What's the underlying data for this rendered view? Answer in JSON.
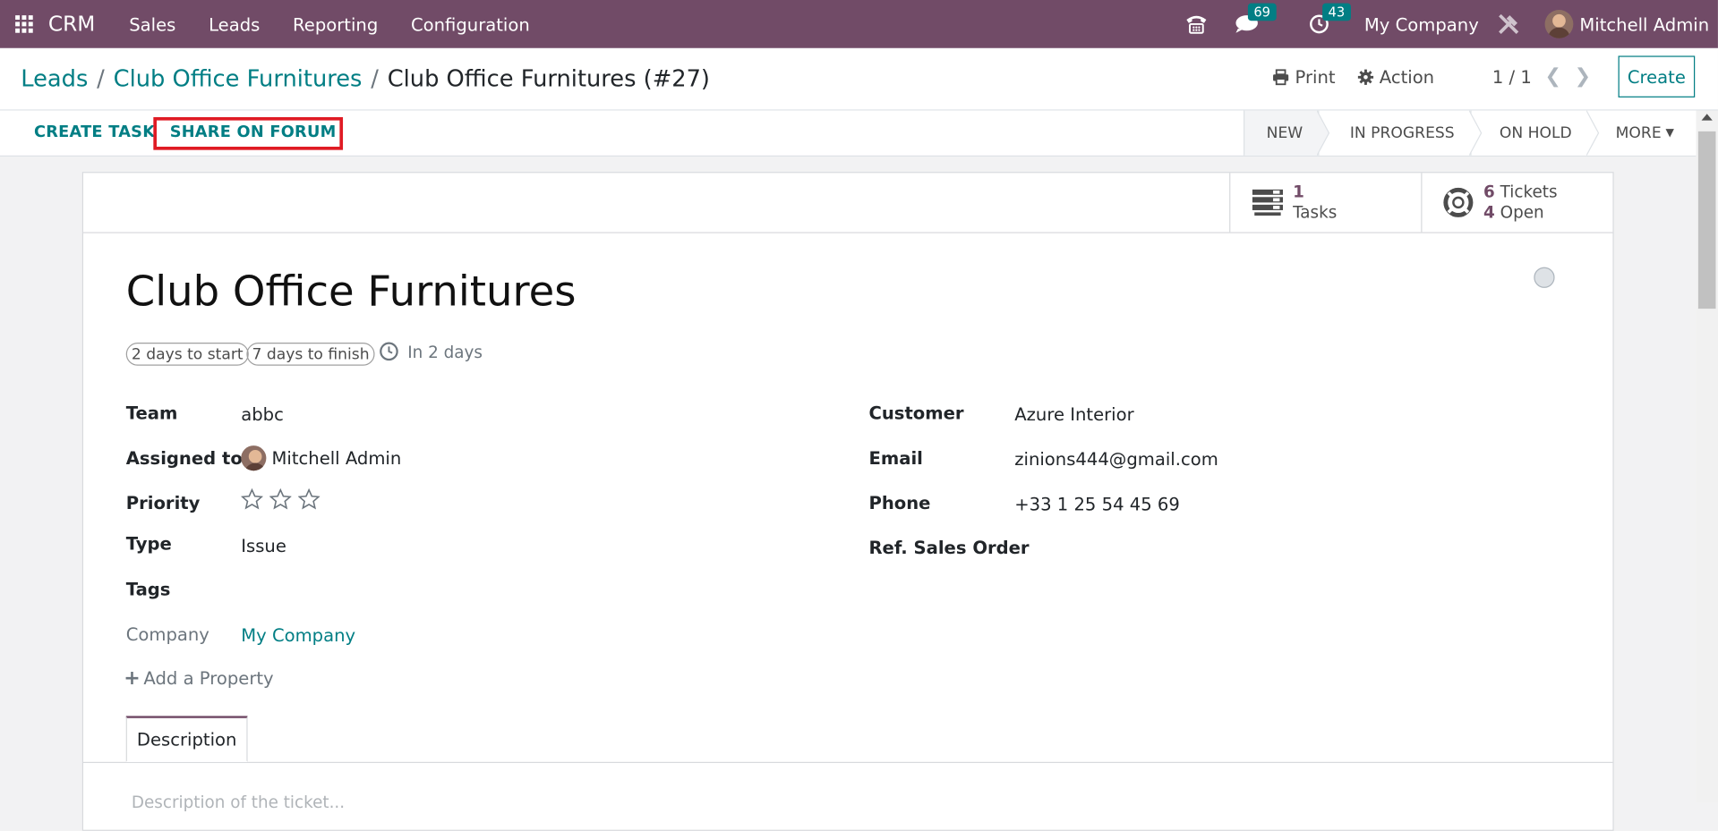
{
  "navbar": {
    "brand": "CRM",
    "menus": [
      "Sales",
      "Leads",
      "Reporting",
      "Configuration"
    ],
    "messages_count": "69",
    "activities_count": "43",
    "company": "My Company",
    "user": "Mitchell Admin"
  },
  "breadcrumb": {
    "root": "Leads",
    "parent": "Club Office Furnitures",
    "current": "Club Office Furnitures (#27)"
  },
  "control": {
    "print": "Print",
    "action": "Action",
    "pager": "1 / 1",
    "create": "Create"
  },
  "statusbar": {
    "create_task": "CREATE TASK",
    "share_forum": "SHARE ON FORUM",
    "stages": [
      "NEW",
      "IN PROGRESS",
      "ON HOLD"
    ],
    "more": "MORE"
  },
  "stats": {
    "tasks_count": "1",
    "tasks_label": "Tasks",
    "tickets_count": "6",
    "tickets_label": "Tickets",
    "open_count": "4",
    "open_label": "Open"
  },
  "record": {
    "title": "Club Office Furnitures",
    "days_to_start": "2 days to start",
    "days_to_finish": "7 days to finish",
    "deadline": "In 2 days",
    "priority_stars": 0,
    "fields_left": {
      "team_label": "Team",
      "team": "abbc",
      "assigned_label": "Assigned to",
      "assigned": "Mitchell Admin",
      "priority_label": "Priority",
      "type_label": "Type",
      "type": "Issue",
      "tags_label": "Tags",
      "company_label": "Company",
      "company": "My Company"
    },
    "fields_right": {
      "customer_label": "Customer",
      "customer": "Azure Interior",
      "email_label": "Email",
      "email": "zinions444@gmail.com",
      "phone_label": "Phone",
      "phone": "+33 1 25 54 45 69",
      "sales_order_label": "Ref. Sales Order"
    },
    "add_property": "Add a Property",
    "tab_description": "Description",
    "description_placeholder": "Description of the ticket..."
  },
  "colors": {
    "brand": "#714b67",
    "accent": "#017e84",
    "highlight": "#e01b24"
  }
}
